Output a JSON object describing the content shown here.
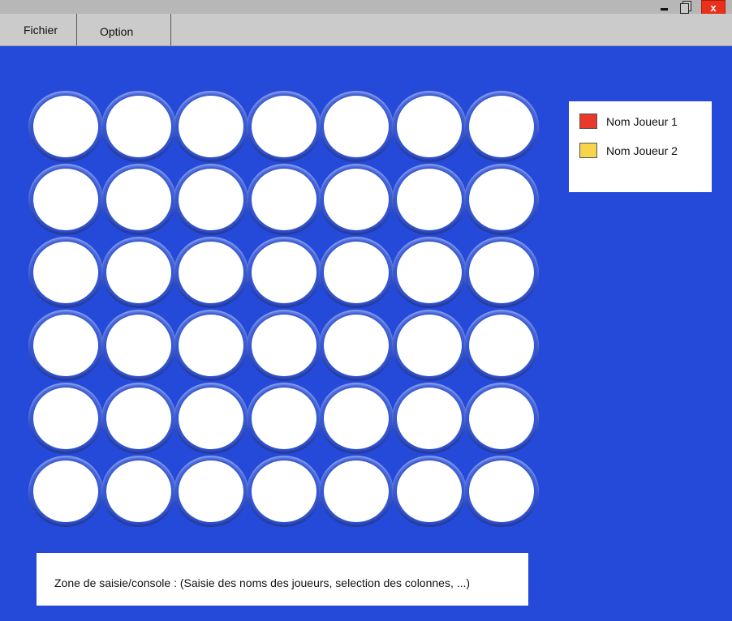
{
  "window": {
    "controls": {
      "minimize_icon": "minimize-icon",
      "restore_icon": "restore-icon",
      "close_label": "x"
    },
    "colors": {
      "background": "#2549d8",
      "titlebar": "#b7b7b7",
      "menubar": "#cbcbcb",
      "close": "#e8301a"
    }
  },
  "menu": {
    "items": [
      {
        "label": "Fichier"
      },
      {
        "label": "Option"
      }
    ]
  },
  "board": {
    "columns": 7,
    "rows": 6,
    "cell_state": "empty"
  },
  "legend": {
    "players": [
      {
        "name": "Nom Joueur 1",
        "color": "#e8392b"
      },
      {
        "name": "Nom Joueur 2",
        "color": "#f8d44a"
      }
    ]
  },
  "console": {
    "text": "Zone de saisie/console : (Saisie des noms des joueurs, selection des colonnes, ...)"
  }
}
